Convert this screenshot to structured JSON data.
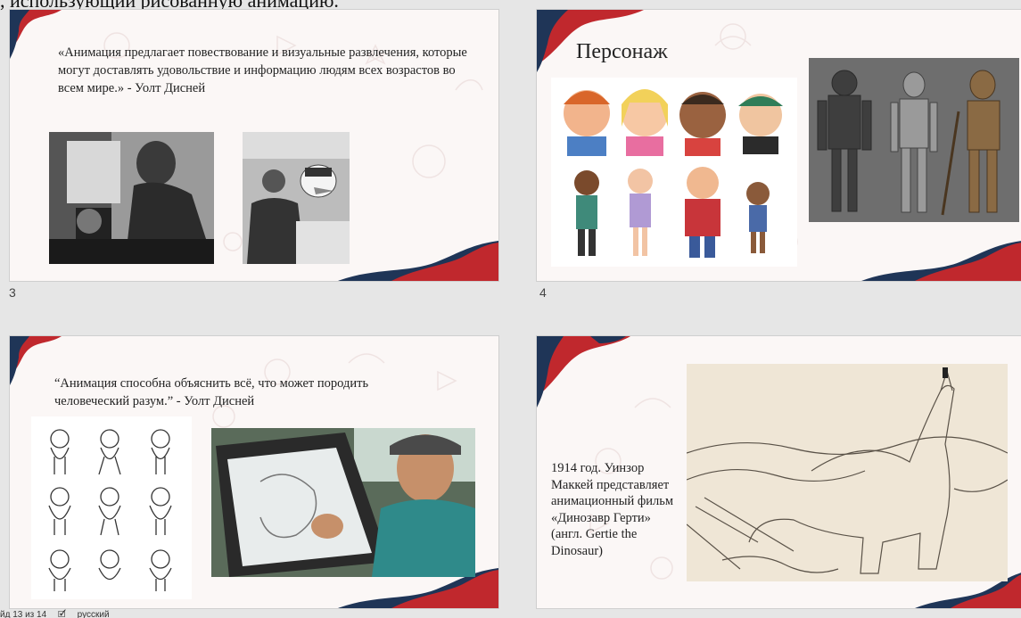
{
  "header_fragment": ", использующий рисованную анимацию.",
  "slides": [
    {
      "number": "3",
      "quote": "«Анимация предлагает повествование и визуальные развлечения, которые могут доставлять удовольствие и информацию людям всех возрастов во всем мире.» - Уолт Дисней",
      "images": [
        "walt-disney-at-microscope-photo",
        "walt-disney-with-donald-duck-photo"
      ]
    },
    {
      "number": "4",
      "title": "Персонаж",
      "images": [
        "cartoon-children-characters-image",
        "steampunk-robot-concepts-image"
      ]
    },
    {
      "number": "",
      "quote": "“Анимация способна объяснить всё, что может породить человеческий разум.” - Уолт Дисней",
      "images": [
        "mouse-character-sketches-image",
        "animator-drawing-on-tablet-photo"
      ]
    },
    {
      "number": "",
      "caption": "1914 год. Уинзор Маккей представляет анимационный фильм «Динозавр Герти» (англ. Gertie the Dinosaur)",
      "images": [
        "gertie-dinosaur-drawing-image"
      ]
    }
  ],
  "statusbar": {
    "slide_counter": "йд 13 из 14",
    "language": "русский"
  },
  "colors": {
    "red": "#c0282d",
    "navy": "#1f3557",
    "slide_bg": "#fbf7f6"
  }
}
